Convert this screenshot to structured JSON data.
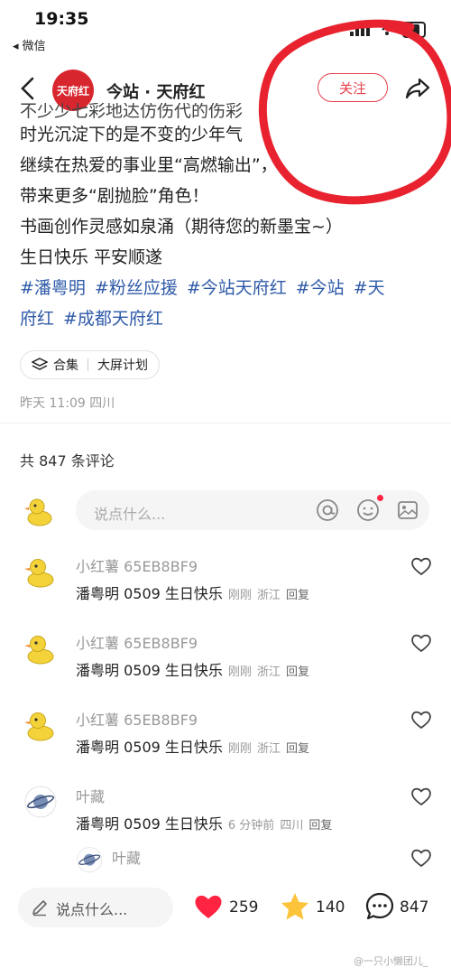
{
  "status_bar": {
    "time": "19:35",
    "back_app": "◂ 微信"
  },
  "header": {
    "account": "今站 · 天府红",
    "avatar_text": "天府红",
    "follow_label": "关注"
  },
  "post": {
    "cut_line": "不少少七彩地达仿伤代的伤彩",
    "lines": [
      "时光沉淀下的是不变的少年气",
      "继续在热爱的事业里“高燃输出”，",
      "带来更多“剧抛脸”角色！",
      "书画创作灵感如泉涌（期待您的新墨宝~）",
      "生日快乐 平安顺遂"
    ],
    "tags_line1": [
      "#潘粤明",
      "#粉丝应援",
      "#今站天府红",
      "#今站",
      "#天"
    ],
    "tags_line2": [
      "府红",
      "#成都天府红"
    ],
    "chip_collection": "合集",
    "chip_plan": "大屏计划",
    "meta": "昨天 11:09 四川"
  },
  "comments_count": "共 847 条评论",
  "comment_input_placeholder": "说点什么...",
  "comments": [
    {
      "name": "小红薯 65EB8BF9",
      "text": "潘粤明 0509 生日快乐",
      "time": "刚刚",
      "loc": "浙江",
      "reply": "回复"
    },
    {
      "name": "小红薯 65EB8BF9",
      "text": "潘粤明 0509 生日快乐",
      "time": "刚刚",
      "loc": "浙江",
      "reply": "回复"
    },
    {
      "name": "小红薯 65EB8BF9",
      "text": "潘粤明 0509 生日快乐",
      "time": "刚刚",
      "loc": "浙江",
      "reply": "回复"
    },
    {
      "name": "叶藏",
      "text": "潘粤明 0509 生日快乐",
      "time": "6 分钟前",
      "loc": "四川",
      "reply": "回复"
    },
    {
      "name": "叶藏",
      "text": "",
      "time": "",
      "loc": "",
      "reply": ""
    }
  ],
  "bottom_bar": {
    "placeholder": "说点什么...",
    "likes": "259",
    "favorites": "140",
    "comments": "847"
  },
  "watermark": "@一只小懒团儿_",
  "colors": {
    "accent": "#ff2442",
    "follow": "#e5404a",
    "tag": "#2f5aa8",
    "overlay_circle": "#e8232f"
  }
}
